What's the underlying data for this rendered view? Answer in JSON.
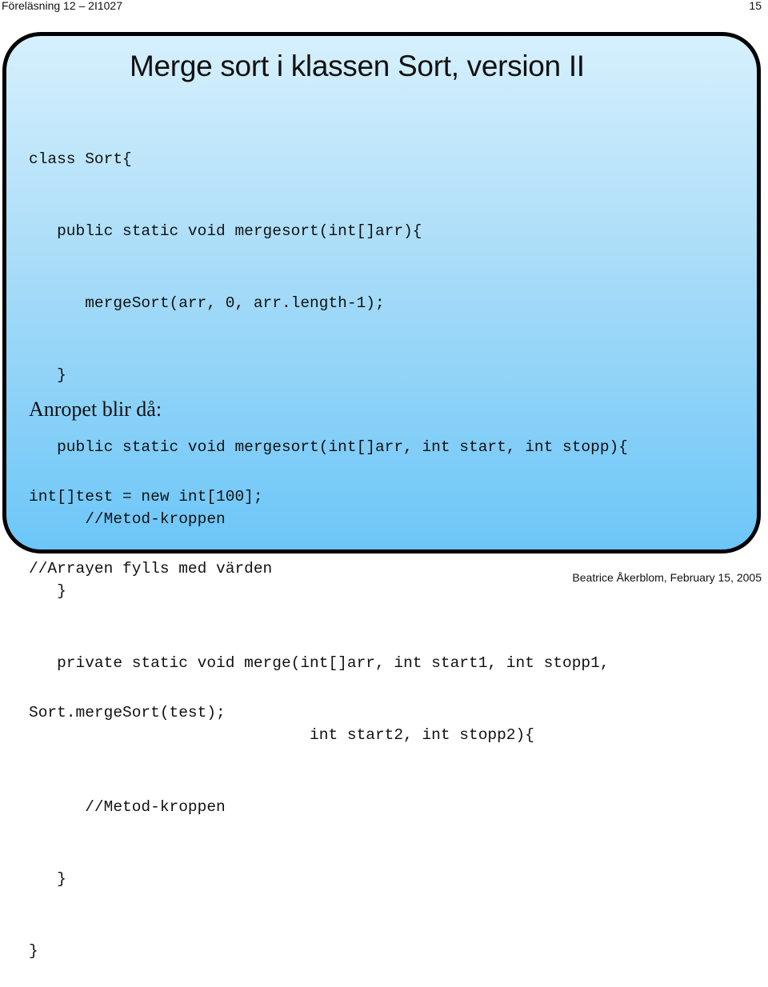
{
  "header": {
    "left": "Föreläsning 12 – 2I1027",
    "page_number": "15"
  },
  "footer": {
    "author_date": "Beatrice Åkerblom, February 15, 2005"
  },
  "slide": {
    "title": "Merge sort i klassen Sort, version II",
    "code_lines": [
      "class Sort{",
      "   public static void mergesort(int[]arr){",
      "      mergeSort(arr, 0, arr.length-1);",
      "   }",
      "   public static void mergesort(int[]arr, int start, int stopp){",
      "      //Metod-kroppen",
      "   }",
      "   private static void merge(int[]arr, int start1, int stopp1,",
      "                              int start2, int stopp2){",
      "      //Metod-kroppen",
      "   }",
      "}"
    ],
    "call_heading": "Anropet blir då:",
    "call_lines": [
      "int[]test = new int[100];",
      "//Arrayen fylls med värden",
      "",
      "Sort.mergeSort(test);"
    ]
  }
}
